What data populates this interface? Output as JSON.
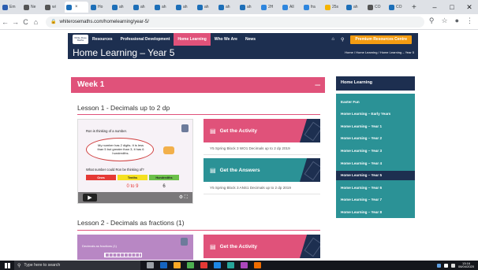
{
  "browser": {
    "tabs": [
      {
        "label": "Em",
        "color": "#2a5db0"
      },
      {
        "label": "Ne",
        "color": "#555555"
      },
      {
        "label": "wi",
        "color": "#555555"
      },
      {
        "label": "",
        "color": "#1d6fb8",
        "active": true
      },
      {
        "label": "Ho",
        "color": "#1d6fb8"
      },
      {
        "label": "ah",
        "color": "#1d6fb8"
      },
      {
        "label": "ah",
        "color": "#1d6fb8"
      },
      {
        "label": "ah",
        "color": "#1d6fb8"
      },
      {
        "label": "ah",
        "color": "#1d6fb8"
      },
      {
        "label": "ah",
        "color": "#1d6fb8"
      },
      {
        "label": "ah",
        "color": "#1d6fb8"
      },
      {
        "label": "ah",
        "color": "#1d6fb8"
      },
      {
        "label": "2H",
        "color": "#2e86de"
      },
      {
        "label": "All",
        "color": "#2e86de"
      },
      {
        "label": "fra",
        "color": "#2e86de"
      },
      {
        "label": "25s",
        "color": "#f5b400"
      },
      {
        "label": "ah",
        "color": "#1d6fb8"
      },
      {
        "label": "CO",
        "color": "#555555"
      },
      {
        "label": "CO",
        "color": "#1d6fb8"
      }
    ],
    "new_tab": "+",
    "window_controls": [
      "–",
      "□",
      "✕"
    ],
    "url": "whiterosemaths.com/homelearning/year-5/",
    "back": "←",
    "forward": "→",
    "reload": "C",
    "home": "⌂",
    "right_icons": [
      "⚲",
      "☆",
      "●",
      "⋮"
    ]
  },
  "site": {
    "logo_text": "White Rose Maths",
    "nav": [
      "White",
      "Resources",
      "Professional Development",
      "Home Learning",
      "Who We Are",
      "News"
    ],
    "nav_active_index": 3,
    "premium_label": "Premium Resources Centre",
    "page_title": "Home Learning – Year 5",
    "breadcrumb": "Home / Home Learning / Home Learning – Year 5"
  },
  "week": {
    "title": "Week 1",
    "toggle": "–",
    "lesson1": {
      "title": "Lesson 1 - Decimals up to 2 dp",
      "video": {
        "line1": "Ron is thinking of a number.",
        "bubble": "My number has 2 digits. It is less than 5 but greater than 3, it has 6 hundredths.",
        "question": "What number could Ron be thinking of?",
        "headers": [
          "Ones",
          "Tenths",
          "Hundredths"
        ],
        "values": [
          "",
          "0 to 9",
          "6"
        ],
        "play": "▶",
        "controls": "⚙ ⛶"
      },
      "activity_label": "Get the Activity",
      "activity_sub": "Y5 Spring Block 3 WO1 Decimals up to 2 dp 2019",
      "answers_label": "Get the Answers",
      "answers_sub": "Y5 Spring Block 3 ANS1 Decimals up to 2 dp 2019"
    },
    "lesson2": {
      "title": "Lesson 2 - Decimals as fractions (1)",
      "thumb_caption": "Decimals as fractions (1)",
      "activity_label": "Get the Activity"
    }
  },
  "sidebar": {
    "heading": "Home Learning",
    "items": [
      "Easter Fun",
      "Home Learning – Early Years",
      "Home Learning – Year 1",
      "Home Learning – Year 2",
      "Home Learning – Year 3",
      "Home Learning – Year 4",
      "Home Learning – Year 5",
      "Home Learning – Year 6",
      "Home Learning – Year 7",
      "Home Learning – Year 8"
    ],
    "active_index": 6
  },
  "taskbar": {
    "search_placeholder": "Type here to search",
    "time": "13:16",
    "date": "06/04/2020",
    "app_colors": [
      "#9aa0a6",
      "#1565c0",
      "#f9a825",
      "#4caf50",
      "#e53935",
      "#1e88e5",
      "#26a69a",
      "#ab47bc",
      "#ef6c00"
    ]
  },
  "colors": {
    "navy": "#1d2f50",
    "pink": "#e0527a",
    "teal": "#2b9296",
    "orange": "#f39c12"
  }
}
